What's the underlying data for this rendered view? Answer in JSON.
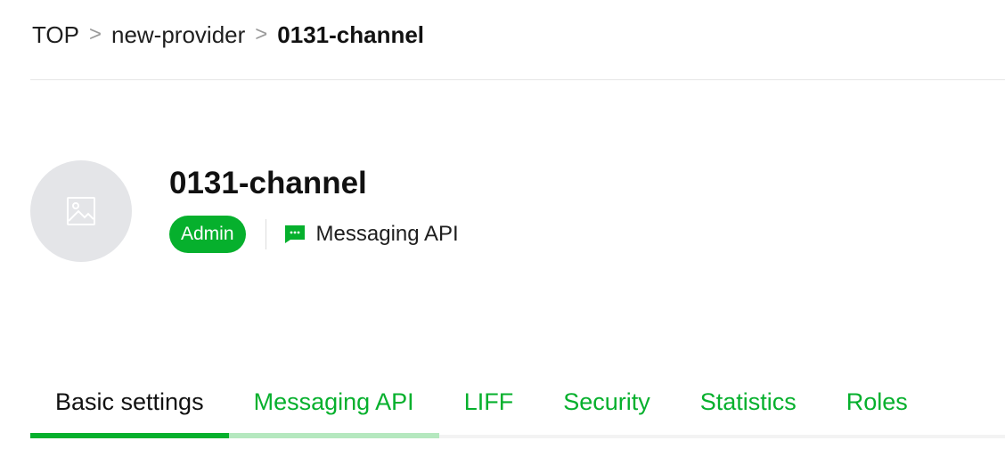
{
  "breadcrumb": {
    "items": [
      "TOP",
      "new-provider"
    ],
    "current": "0131-channel",
    "separator": ">"
  },
  "channel": {
    "avatar_icon": "image-placeholder-icon",
    "title": "0131-channel",
    "role_badge": "Admin",
    "type_icon": "chat-bubble-icon",
    "type_label": "Messaging API"
  },
  "tabs": [
    {
      "label": "Basic settings",
      "state": "active"
    },
    {
      "label": "Messaging API",
      "state": "hover"
    },
    {
      "label": "LIFF",
      "state": "default"
    },
    {
      "label": "Security",
      "state": "default"
    },
    {
      "label": "Statistics",
      "state": "default"
    },
    {
      "label": "Roles",
      "state": "default"
    }
  ],
  "colors": {
    "accent": "#06b02d",
    "accent_light": "#b5e8bf",
    "avatar_bg": "#e4e5e8",
    "text": "#1e1e1e"
  }
}
